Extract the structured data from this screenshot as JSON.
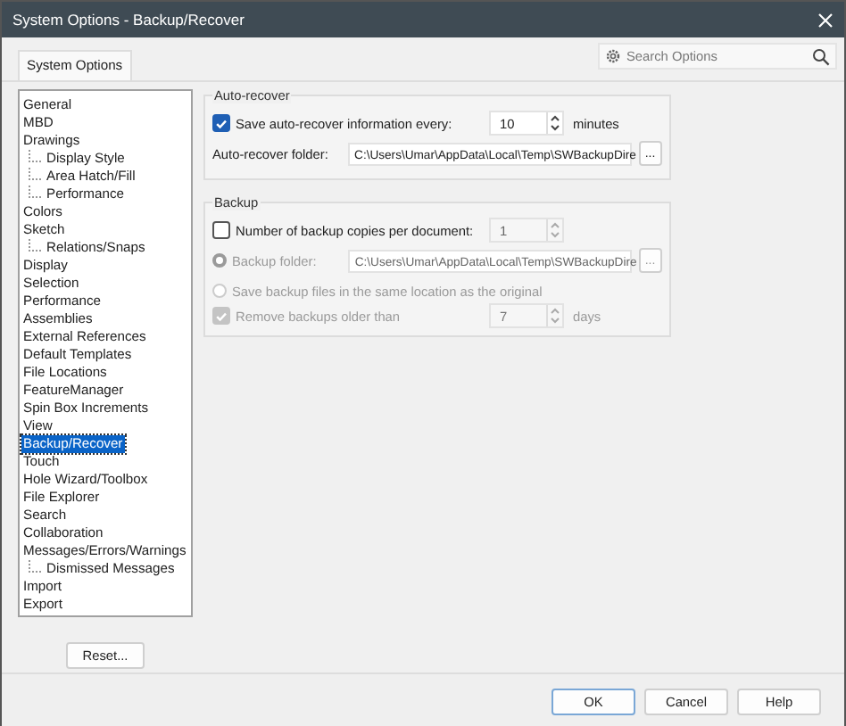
{
  "window": {
    "title": "System Options - Backup/Recover"
  },
  "tabs": [
    {
      "label": "System Options",
      "selected": true
    }
  ],
  "search": {
    "placeholder": "Search Options"
  },
  "tree": [
    {
      "label": "General",
      "selected": false
    },
    {
      "label": "MBD",
      "selected": false
    },
    {
      "label": "Drawings",
      "selected": false,
      "children": [
        {
          "label": "Display Style",
          "selected": false
        },
        {
          "label": "Area Hatch/Fill",
          "selected": false
        },
        {
          "label": "Performance",
          "selected": false
        }
      ]
    },
    {
      "label": "Colors",
      "selected": false
    },
    {
      "label": "Sketch",
      "selected": false,
      "children": [
        {
          "label": "Relations/Snaps",
          "selected": false
        }
      ]
    },
    {
      "label": "Display",
      "selected": false
    },
    {
      "label": "Selection",
      "selected": false
    },
    {
      "label": "Performance",
      "selected": false
    },
    {
      "label": "Assemblies",
      "selected": false
    },
    {
      "label": "External References",
      "selected": false
    },
    {
      "label": "Default Templates",
      "selected": false
    },
    {
      "label": "File Locations",
      "selected": false
    },
    {
      "label": "FeatureManager",
      "selected": false
    },
    {
      "label": "Spin Box Increments",
      "selected": false
    },
    {
      "label": "View",
      "selected": false
    },
    {
      "label": "Backup/Recover",
      "selected": true
    },
    {
      "label": "Touch",
      "selected": false
    },
    {
      "label": "Hole Wizard/Toolbox",
      "selected": false
    },
    {
      "label": "File Explorer",
      "selected": false
    },
    {
      "label": "Search",
      "selected": false
    },
    {
      "label": "Collaboration",
      "selected": false
    },
    {
      "label": "Messages/Errors/Warnings",
      "selected": false,
      "children": [
        {
          "label": "Dismissed Messages",
          "selected": false
        }
      ]
    },
    {
      "label": "Import",
      "selected": false
    },
    {
      "label": "Export",
      "selected": false
    }
  ],
  "reset_button": "Reset...",
  "groups": [
    {
      "title": "Auto-recover",
      "rows": [
        {
          "kind": "check",
          "label": "Save auto-recover information every:",
          "checked": true,
          "disabled": false,
          "value": "10",
          "unit": "minutes"
        },
        {
          "kind": "folder",
          "label": "Auto-recover folder:",
          "disabled": false,
          "value": "C:\\Users\\Umar\\AppData\\Local\\Temp\\SWBackupDire",
          "button": "..."
        }
      ]
    },
    {
      "title": "Backup",
      "rows": [
        {
          "kind": "check",
          "label": "Number of backup copies per document:",
          "checked": false,
          "disabled": false,
          "value": "1"
        },
        {
          "kind": "radio-folder",
          "label": "Backup folder:",
          "selected": true,
          "disabled": true,
          "value": "C:\\Users\\Umar\\AppData\\Local\\Temp\\SWBackupDire",
          "button": "..."
        },
        {
          "kind": "radio",
          "label": "Save backup files in the same location as the original",
          "selected": false,
          "disabled": true
        },
        {
          "kind": "check",
          "label": "Remove backups older than",
          "checked": true,
          "disabled": true,
          "value": "7",
          "unit": "days"
        }
      ]
    }
  ],
  "buttons": [
    "OK",
    "Cancel",
    "Help"
  ]
}
